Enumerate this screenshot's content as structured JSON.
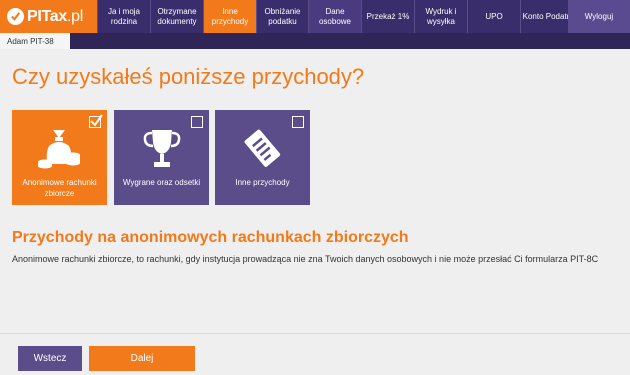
{
  "brand": {
    "name_bold": "PITax",
    "name_light": ".pl"
  },
  "nav": [
    {
      "label": "Ja i moja rodzina",
      "width": 53,
      "state": "normal"
    },
    {
      "label": "Otrzymane dokumenty",
      "width": 53,
      "state": "normal"
    },
    {
      "label": "Inne przychody",
      "width": 53,
      "state": "active"
    },
    {
      "label": "Obniżanie podatku",
      "width": 52,
      "state": "normal"
    },
    {
      "label": "Dane osobowe",
      "width": 53,
      "state": "alt"
    },
    {
      "label": "Przekaż 1%",
      "width": 53,
      "state": "normal"
    },
    {
      "label": "Wydruk i wysyłka",
      "width": 53,
      "state": "normal"
    },
    {
      "label": "UPO",
      "width": 53,
      "state": "normal"
    },
    {
      "label": "Konto Podatnika",
      "width": 63,
      "state": "normal"
    }
  ],
  "logout_label": "Wyloguj",
  "tab_label": "Adam PIT-38",
  "question": "Czy uzyskałeś poniższe przychody?",
  "tiles": [
    {
      "label": "Anonimowe rachunki zbiorcze",
      "selected": true,
      "icon": "money-bag-icon"
    },
    {
      "label": "Wygrane oraz odsetki",
      "selected": false,
      "icon": "trophy-icon"
    },
    {
      "label": "Inne przychody",
      "selected": false,
      "icon": "document-icon"
    }
  ],
  "section_title": "Przychody na anonimowych rachunkach zbiorczych",
  "section_desc": "Anonimowe rachunki zbiorcze, to rachunki, gdy instytucja prowadząca nie zna Twoich danych osobowych i nie może przesłać Ci formularza PIT-8C",
  "buttons": {
    "back": "Wstecz",
    "next": "Dalej"
  },
  "colors": {
    "orange": "#f27a1a",
    "purple": "#5b4c8a",
    "navy": "#3a2d6b"
  }
}
